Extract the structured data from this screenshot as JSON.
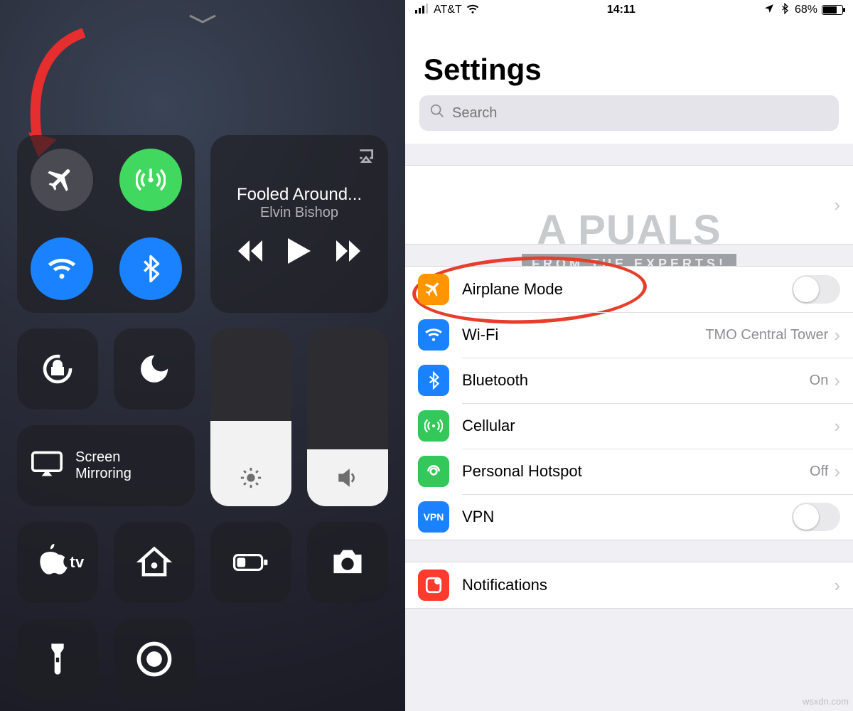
{
  "control_center": {
    "music": {
      "title": "Fooled Around...",
      "artist": "Elvin Bishop"
    },
    "screen_mirroring": "Screen\nMirroring",
    "brightness_pct": 48,
    "volume_pct": 32,
    "appletv_label": "tv"
  },
  "settings": {
    "status": {
      "carrier": "AT&T",
      "time": "14:11",
      "battery": "68%"
    },
    "title": "Settings",
    "search_placeholder": "Search",
    "rows": {
      "airplane": {
        "label": "Airplane Mode"
      },
      "wifi": {
        "label": "Wi-Fi",
        "value": "TMO Central Tower"
      },
      "bluetooth": {
        "label": "Bluetooth",
        "value": "On"
      },
      "cellular": {
        "label": "Cellular"
      },
      "hotspot": {
        "label": "Personal Hotspot",
        "value": "Off"
      },
      "vpn": {
        "label": "VPN",
        "icon_text": "VPN"
      },
      "notifications": {
        "label": "Notifications"
      }
    }
  },
  "watermark": {
    "brand": "A PUALS",
    "sub": "FROM THE EXPERTS!"
  },
  "credit": "wsxdn.com"
}
